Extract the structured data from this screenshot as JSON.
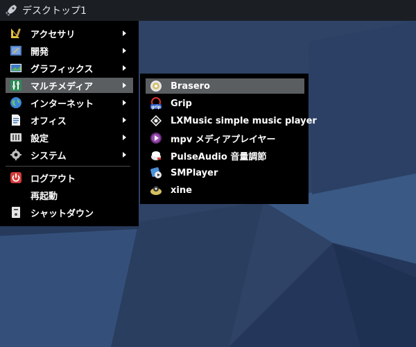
{
  "topbar": {
    "title": "デスクトップ1",
    "icon": "rocket-icon"
  },
  "main_menu": {
    "items": [
      {
        "label": "アクセサリ",
        "icon": "accessories-icon",
        "submenu": true
      },
      {
        "label": "開発",
        "icon": "development-icon",
        "submenu": true
      },
      {
        "label": "グラフィックス",
        "icon": "graphics-icon",
        "submenu": true
      },
      {
        "label": "マルチメディア",
        "icon": "multimedia-icon",
        "submenu": true,
        "highlighted": true
      },
      {
        "label": "インターネット",
        "icon": "internet-icon",
        "submenu": true
      },
      {
        "label": "オフィス",
        "icon": "office-icon",
        "submenu": true
      },
      {
        "label": "設定",
        "icon": "settings-icon",
        "submenu": true
      },
      {
        "label": "システム",
        "icon": "system-icon",
        "submenu": true
      },
      {
        "label": "ログアウト",
        "icon": "logout-icon",
        "submenu": false
      },
      {
        "label": "再起動",
        "icon": "",
        "submenu": false
      },
      {
        "label": "シャットダウン",
        "icon": "shutdown-icon",
        "submenu": false
      }
    ]
  },
  "sub_menu": {
    "items": [
      {
        "label": "Brasero",
        "icon": "brasero-icon",
        "highlighted": true
      },
      {
        "label": "Grip",
        "icon": "grip-icon"
      },
      {
        "label": "LXMusic simple music player",
        "icon": "lxmusic-icon"
      },
      {
        "label": "mpv メディアプレイヤー",
        "icon": "mpv-icon"
      },
      {
        "label": "PulseAudio 音量調節",
        "icon": "pulseaudio-icon"
      },
      {
        "label": "SMPlayer",
        "icon": "smplayer-icon"
      },
      {
        "label": "xine",
        "icon": "xine-icon"
      }
    ]
  },
  "colors": {
    "desktop": "#2f4468",
    "menu": "#000000",
    "highlight": "#5b5e61",
    "topbar": "#1b1f24"
  }
}
